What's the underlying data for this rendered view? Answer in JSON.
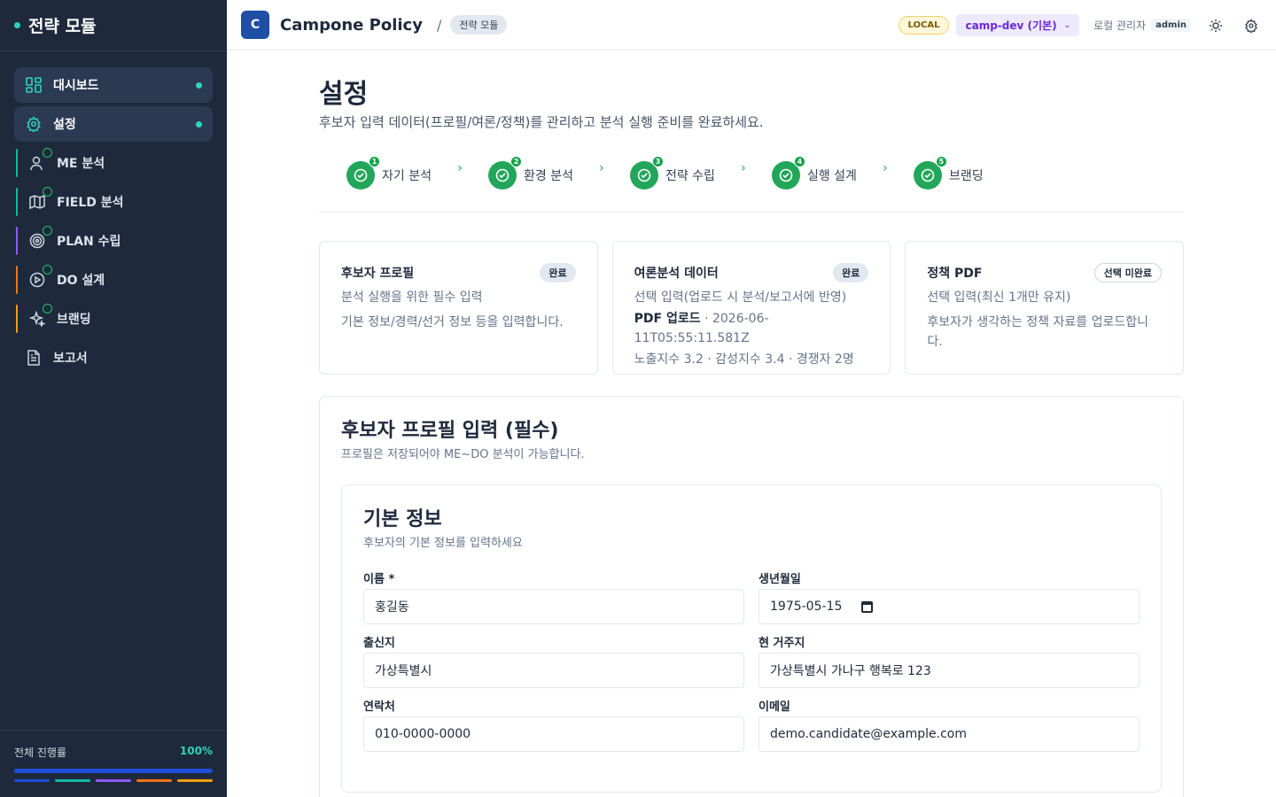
{
  "sidebar": {
    "title": "전략 모듈",
    "items": [
      {
        "label": "대시보드"
      },
      {
        "label": "설정"
      },
      {
        "label": "ME 분석"
      },
      {
        "label": "FIELD 분석"
      },
      {
        "label": "PLAN 수립"
      },
      {
        "label": "DO 설계"
      },
      {
        "label": "브랜딩"
      },
      {
        "label": "보고서"
      }
    ],
    "progress": {
      "label": "전체 진행률",
      "value_text": "100%",
      "value": 1.0
    },
    "colors": {
      "accent": "#2dd4bf",
      "me": "#14b8a6",
      "field": "#14b8a6",
      "plan": "#8b5cf6",
      "do": "#f97316",
      "branding": "#f59e0b"
    }
  },
  "header": {
    "logo_letter": "C",
    "app_title": "Campone Policy",
    "breadcrumb_sep": "/",
    "breadcrumb": "전략 모듈",
    "env_badge": "LOCAL",
    "env_select": "camp-dev (기본)",
    "user_name": "로컬 관리자",
    "user_role": "admin",
    "icons": [
      "sun-icon",
      "gear-icon"
    ]
  },
  "page": {
    "title": "설정",
    "subtitle": "후보자 입력 데이터(프로필/여론/정책)를 관리하고 분석 실행 준비를 완료하세요."
  },
  "steps": [
    {
      "num": "1",
      "label": "자기 분석"
    },
    {
      "num": "2",
      "label": "환경 분석"
    },
    {
      "num": "3",
      "label": "전략 수립"
    },
    {
      "num": "4",
      "label": "실행 설계"
    },
    {
      "num": "5",
      "label": "브랜딩"
    }
  ],
  "cards": [
    {
      "title": "후보자 프로필",
      "status": "완료",
      "line1": "분석 실행을 위한 필수 입력",
      "line2": "기본 정보/경력/선거 정보 등을 입력합니다."
    },
    {
      "title": "여론분석 데이터",
      "status": "완료",
      "line1": "선택 입력(업로드 시 분석/보고서에 반영)",
      "line2_bold": "PDF 업로드",
      "line2": " · 2026-06-11T05:55:11.581Z",
      "line3": "노출지수 3.2 · 감성지수 3.4 · 경쟁자 2명"
    },
    {
      "title": "정책 PDF",
      "status": "선택 미완료",
      "line1": "선택 입력(최신 1개만 유지)",
      "line2": "후보자가 생각하는 정책 자료를 업로드합니다."
    }
  ],
  "profile_panel": {
    "title": "후보자 프로필 입력 (필수)",
    "subtitle": "프로필은 저장되어야 ME~DO 분석이 가능합니다.",
    "section": {
      "title": "기본 정보",
      "subtitle": "후보자의 기본 정보를 입력하세요",
      "fields": {
        "name": {
          "label": "이름 *",
          "value": "홍길동"
        },
        "birth": {
          "label": "생년월일",
          "value": "1975-05-15"
        },
        "hometown": {
          "label": "출신지",
          "value": "가상특별시"
        },
        "residence": {
          "label": "현 거주지",
          "value": "가상특별시 가나구 행복로 123"
        },
        "phone": {
          "label": "연락처",
          "value": "010-0000-0000"
        },
        "email": {
          "label": "이메일",
          "value": "demo.candidate@example.com"
        }
      }
    }
  }
}
